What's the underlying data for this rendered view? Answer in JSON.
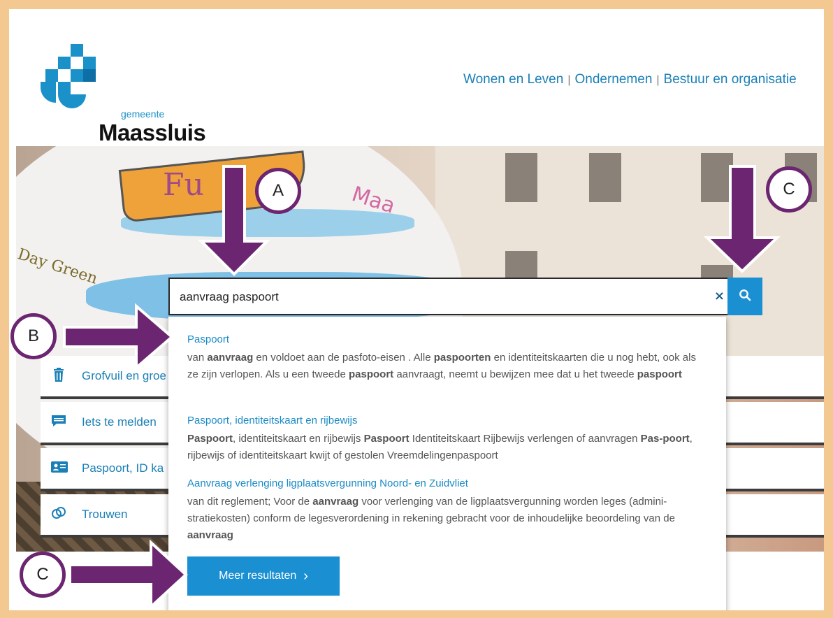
{
  "header": {
    "logo_small": "gemeente",
    "logo_big": "Maassluis",
    "nav": [
      "Wonen en Leven",
      "Ondernemen",
      "Bestuur en organisatie"
    ],
    "nav_separator": "|"
  },
  "search": {
    "value": "aanvraag paspoort",
    "clear_icon": "×",
    "button_icon": "search-icon"
  },
  "quick_links": [
    {
      "label": "Grofvuil en groe",
      "icon": "trash-icon"
    },
    {
      "label": "Iets te melden",
      "icon": "chat-icon"
    },
    {
      "label": "Paspoort, ID ka",
      "icon": "id-card-icon"
    },
    {
      "label": "Trouwen",
      "icon": "rings-icon"
    }
  ],
  "results": [
    {
      "title": "Paspoort",
      "snippet_html": "van <b>aanvraag</b> en voldoet aan de pasfoto-eisen . Alle <b>paspoorten</b> en identiteitskaarten die u nog hebt, ook als ze zijn verlopen. Als u een tweede <b>paspoort</b> aanvraagt, neemt u bewijzen mee dat u het tweede <b>paspoort</b>"
    },
    {
      "title": "Paspoort, identiteitskaart en rijbewijs",
      "snippet_html": "<b>Paspoort</b>, identiteitskaart en rijbewijs <b>Paspoort</b> Identiteitskaart Rijbewijs verlengen of aanvragen <b>Pas-poort</b>, rijbewijs of identiteitskaart kwijt of gestolen Vreemdelingenpaspoort"
    },
    {
      "title": "Aanvraag verlenging ligplaatsvergunning Noord- en Zuidvliet",
      "snippet_html": "van dit reglement; Voor de <b>aanvraag</b> voor verlenging van de ligplaatsvergunning worden leges (admini-stratiekosten) conform de legesverordening in rekening gebracht voor de inhoudelijke beoordeling van de <b>aanvraag</b>"
    }
  ],
  "more_button": {
    "label": "Meer resultaten",
    "chevron": "›"
  },
  "annotations": {
    "a": "A",
    "b": "B",
    "c_top": "C",
    "c_bottom": "C"
  },
  "colors": {
    "frame": "#f4c891",
    "arrow": "#6c2570",
    "accent": "#1a8fd1",
    "link": "#1a7fb6"
  }
}
